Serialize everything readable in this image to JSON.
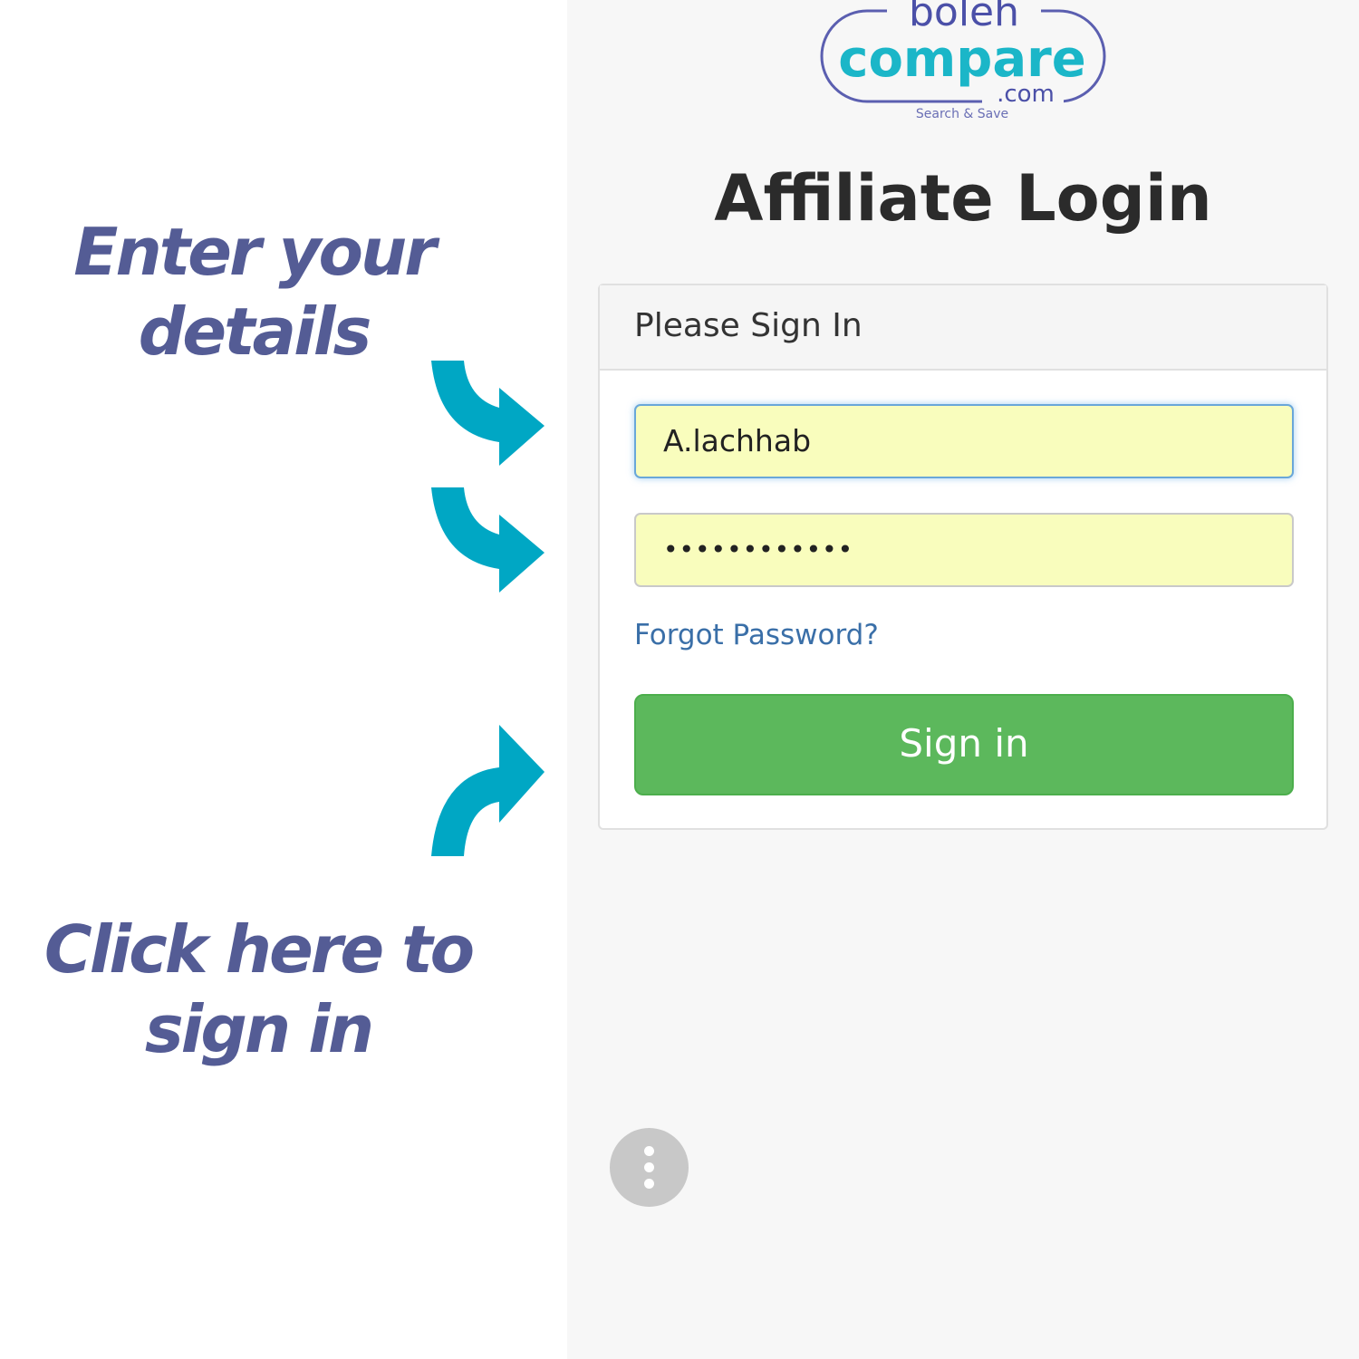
{
  "annotations": {
    "enter_details": [
      "Enter your",
      "details"
    ],
    "click_here": [
      "Click here to",
      "sign in"
    ]
  },
  "logo": {
    "line1": "boleh",
    "line2": "compare",
    "line3": ".com",
    "tagline": "Search & Save"
  },
  "title": "Affiliate Login",
  "panel": {
    "heading": "Please Sign In",
    "username_value": "A.lachhab",
    "password_value": "••••••••••••",
    "forgot_link": "Forgot Password?",
    "signin_button": "Sign in"
  },
  "colors": {
    "annotation": "#545c95",
    "arrow": "#00a7c4",
    "button": "#5cb85c",
    "field_bg": "#f9fdbd"
  }
}
